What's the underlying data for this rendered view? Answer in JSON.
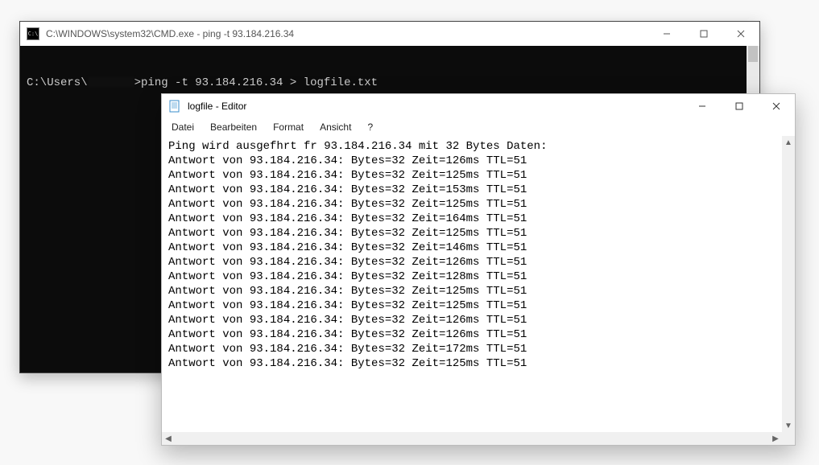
{
  "cmd": {
    "title": "C:\\WINDOWS\\system32\\CMD.exe - ping  -t 93.184.216.34",
    "icon_label": "C:\\",
    "prompt_prefix": "C:\\Users\\",
    "prompt_suffix": ">",
    "command": "ping -t 93.184.216.34 > logfile.txt"
  },
  "notepad": {
    "title": "logfile - Editor",
    "menu": {
      "file": "Datei",
      "edit": "Bearbeiten",
      "format": "Format",
      "view": "Ansicht",
      "help": "?"
    },
    "header_line": "Ping wird ausgefhrt fr 93.184.216.34 mit 32 Bytes Daten:",
    "ip": "93.184.216.34",
    "bytes": 32,
    "ttl": 51,
    "times_ms": [
      126,
      125,
      153,
      125,
      164,
      125,
      146,
      126,
      128,
      125,
      125,
      126,
      126,
      172,
      125
    ]
  }
}
